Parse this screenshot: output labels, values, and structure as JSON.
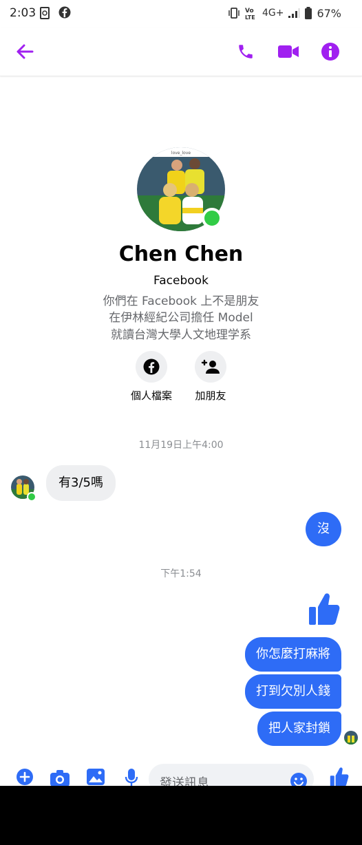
{
  "status_bar": {
    "time": "2:03",
    "network": "4G+",
    "battery": "67%"
  },
  "header": {
    "back_icon": "arrow-left-icon",
    "call_icon": "phone-icon",
    "video_icon": "video-camera-icon",
    "info_icon": "info-icon"
  },
  "colors": {
    "accent": "#a020f0",
    "bubble_out": "#2e6cf6",
    "bubble_in": "#eeeff1",
    "online": "#31cc46"
  },
  "profile": {
    "avatar_caption": "love_love",
    "name": "Chen Chen",
    "platform": "Facebook",
    "lines": [
      "你們在 Facebook 上不是朋友",
      "在伊林經紀公司擔任 Model",
      "就讀台灣大學人文地理学系"
    ],
    "actions": [
      {
        "icon": "facebook-icon",
        "label": "個人檔案"
      },
      {
        "icon": "add-friend-icon",
        "label": "加朋友"
      }
    ]
  },
  "conversation": {
    "timestamp_1": "11月19日上午4:00",
    "incoming_1": "有3/5嗎",
    "outgoing_1": "沒",
    "timestamp_2": "下午1:54",
    "like_icon": "thumbs-up-icon",
    "outgoing_group": [
      "你怎麼打麻將",
      "打到欠別人錢",
      "把人家封鎖"
    ]
  },
  "composer": {
    "placeholder": "發送訊息",
    "icons": [
      "plus-icon",
      "camera-icon",
      "image-icon",
      "microphone-icon",
      "emoji-icon",
      "thumbs-up-icon"
    ]
  }
}
